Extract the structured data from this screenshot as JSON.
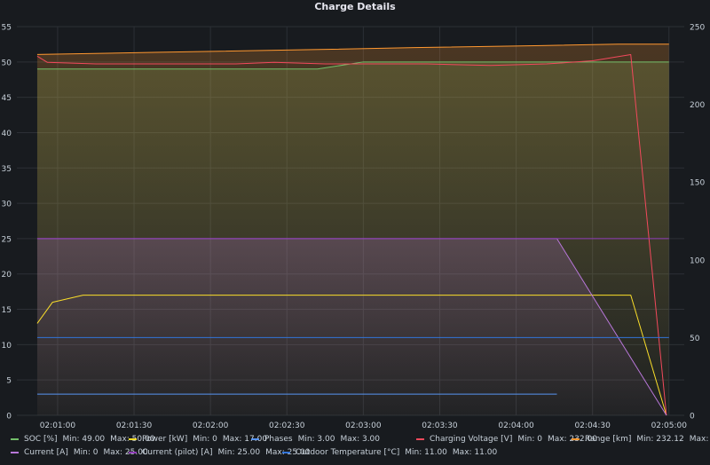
{
  "panel": {
    "title": "Charge Details"
  },
  "colors": {
    "grid": "#2c3036",
    "tick": "#c7d0d9",
    "soc": "#73bf69",
    "power": "#fade2a",
    "phases": "#5794f2",
    "voltage": "#f2495c",
    "range": "#ff9830",
    "current": "#b877d9",
    "current_pilot": "#8f3bb8",
    "outdoor_temp": "#3274d9"
  },
  "chart_data": {
    "type": "line",
    "x_ticks": [
      "02:01:00",
      "02:01:30",
      "02:02:00",
      "02:02:30",
      "02:03:00",
      "02:03:30",
      "02:04:00",
      "02:04:30",
      "02:05:00"
    ],
    "x_tick_seconds": [
      60,
      90,
      120,
      150,
      180,
      210,
      240,
      270,
      300
    ],
    "x_start_seconds": 52,
    "x_range_seconds": [
      44,
      306
    ],
    "y_left": {
      "ticks": [
        0,
        5,
        10,
        15,
        20,
        25,
        30,
        35,
        40,
        45,
        50,
        55
      ],
      "range": [
        0,
        55
      ]
    },
    "y_right": {
      "ticks": [
        0,
        50,
        100,
        150,
        200,
        250
      ],
      "range": [
        0,
        250
      ]
    },
    "series": [
      {
        "key": "soc",
        "name": "SOC [%]",
        "axis": "left",
        "fill": true,
        "min": "49.00",
        "max": "50.00",
        "x": [
          52,
          150,
          162,
          180,
          290,
          300
        ],
        "y": [
          49,
          49,
          49,
          50,
          50,
          50
        ]
      },
      {
        "key": "power",
        "name": "Power [kW]",
        "axis": "left",
        "fill": false,
        "min": "0",
        "max": "17.00",
        "x": [
          52,
          58,
          70,
          285,
          299
        ],
        "y": [
          13,
          16,
          17,
          17,
          0
        ]
      },
      {
        "key": "phases",
        "name": "Phases",
        "axis": "left",
        "fill": false,
        "min": "3.00",
        "max": "3.00",
        "x": [
          52,
          256
        ],
        "y": [
          3,
          3
        ]
      },
      {
        "key": "voltage",
        "name": "Charging Voltage [V]",
        "axis": "right",
        "fill": false,
        "min": "0",
        "max": "232.00",
        "x": [
          52,
          56,
          75,
          100,
          130,
          145,
          165,
          185,
          205,
          230,
          252,
          270,
          285,
          299
        ],
        "y": [
          231,
          227,
          226,
          226,
          226,
          227,
          226,
          226,
          226,
          225,
          226,
          228,
          232,
          0
        ]
      },
      {
        "key": "range",
        "name": "Range [km]",
        "axis": "right",
        "fill": true,
        "min": "232.12",
        "max": "238.71",
        "x": [
          52,
          100,
          160,
          200,
          250,
          280,
          300
        ],
        "y": [
          232.12,
          233.5,
          235.2,
          236.5,
          237.8,
          238.71,
          238.71
        ]
      },
      {
        "key": "current",
        "name": "Current [A]",
        "axis": "left",
        "fill": true,
        "min": "0",
        "max": "25.00",
        "x": [
          52,
          256,
          299
        ],
        "y": [
          25,
          25,
          0
        ]
      },
      {
        "key": "current_pilot",
        "name": "Current (pilot) [A]",
        "axis": "left",
        "fill": false,
        "min": "25.00",
        "max": "25.00",
        "x": [
          52,
          300
        ],
        "y": [
          25,
          25
        ]
      },
      {
        "key": "outdoor_temp",
        "name": "Outdoor Temperature [°C]",
        "axis": "left",
        "fill": false,
        "min": "11.00",
        "max": "11.00",
        "x": [
          52,
          300
        ],
        "y": [
          11,
          11
        ]
      }
    ]
  },
  "legend": {
    "min_label": "Min:",
    "max_label": "Max:",
    "rows": [
      [
        "soc",
        "power",
        "phases",
        "voltage",
        "range"
      ],
      [
        "current",
        "current_pilot",
        "outdoor_temp"
      ]
    ]
  }
}
